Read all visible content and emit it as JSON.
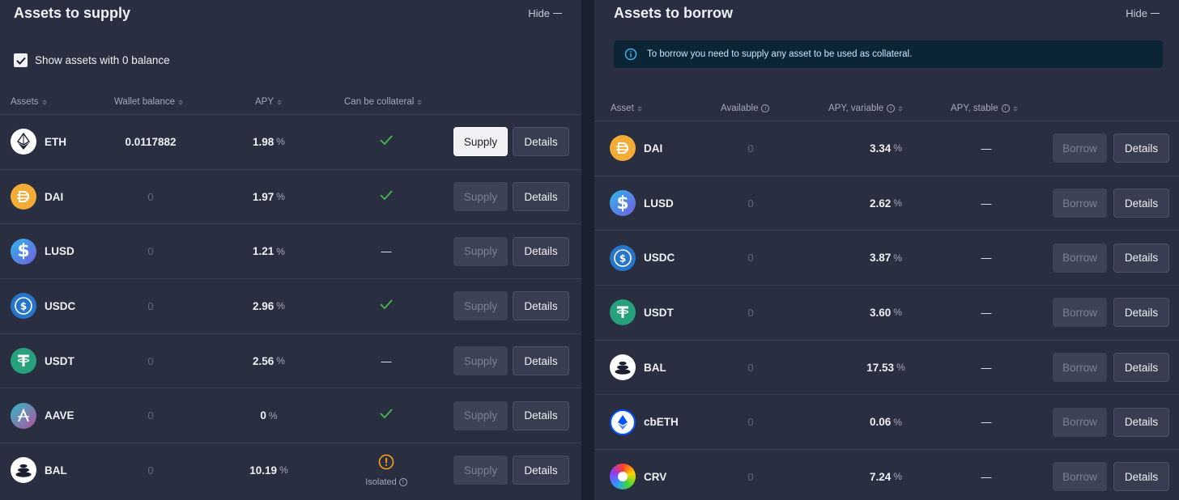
{
  "supply": {
    "title": "Assets to supply",
    "hide_label": "Hide",
    "zero_balance_label": "Show assets with 0 balance",
    "headers": {
      "assets": "Assets",
      "wallet_balance": "Wallet balance",
      "apy": "APY",
      "collateral": "Can be collateral"
    },
    "supply_label": "Supply",
    "details_label": "Details",
    "rows": [
      {
        "symbol": "ETH",
        "balance": "0.0117882",
        "apy": "1.98",
        "collateral": "check",
        "active": true
      },
      {
        "symbol": "DAI",
        "balance": "0",
        "apy": "1.97",
        "collateral": "check",
        "active": false
      },
      {
        "symbol": "LUSD",
        "balance": "0",
        "apy": "1.21",
        "collateral": "dash",
        "active": false
      },
      {
        "symbol": "USDC",
        "balance": "0",
        "apy": "2.96",
        "collateral": "check",
        "active": false
      },
      {
        "symbol": "USDT",
        "balance": "0",
        "apy": "2.56",
        "collateral": "dash",
        "active": false
      },
      {
        "symbol": "AAVE",
        "balance": "0",
        "apy": "0",
        "collateral": "check",
        "active": false
      },
      {
        "symbol": "BAL",
        "balance": "0",
        "apy": "10.19",
        "collateral": "isolated",
        "isolated_label": "Isolated",
        "active": false
      }
    ]
  },
  "borrow": {
    "title": "Assets to borrow",
    "hide_label": "Hide",
    "alert_text": "To borrow you need to supply any asset to be used as collateral.",
    "headers": {
      "asset": "Asset",
      "available": "Available",
      "apy_variable": "APY, variable",
      "apy_stable": "APY, stable"
    },
    "borrow_label": "Borrow",
    "details_label": "Details",
    "rows": [
      {
        "symbol": "DAI",
        "available": "0",
        "apy_variable": "3.34",
        "apy_stable": "—"
      },
      {
        "symbol": "LUSD",
        "available": "0",
        "apy_variable": "2.62",
        "apy_stable": "—"
      },
      {
        "symbol": "USDC",
        "available": "0",
        "apy_variable": "3.87",
        "apy_stable": "—"
      },
      {
        "symbol": "USDT",
        "available": "0",
        "apy_variable": "3.60",
        "apy_stable": "—"
      },
      {
        "symbol": "BAL",
        "available": "0",
        "apy_variable": "17.53",
        "apy_stable": "—"
      },
      {
        "symbol": "cbETH",
        "available": "0",
        "apy_variable": "0.06",
        "apy_stable": "—"
      },
      {
        "symbol": "CRV",
        "available": "0",
        "apy_variable": "7.24",
        "apy_stable": "—"
      }
    ]
  },
  "percent_sign": "%",
  "colors": {
    "check": "#46bc4b",
    "warning": "#f89f1a"
  }
}
